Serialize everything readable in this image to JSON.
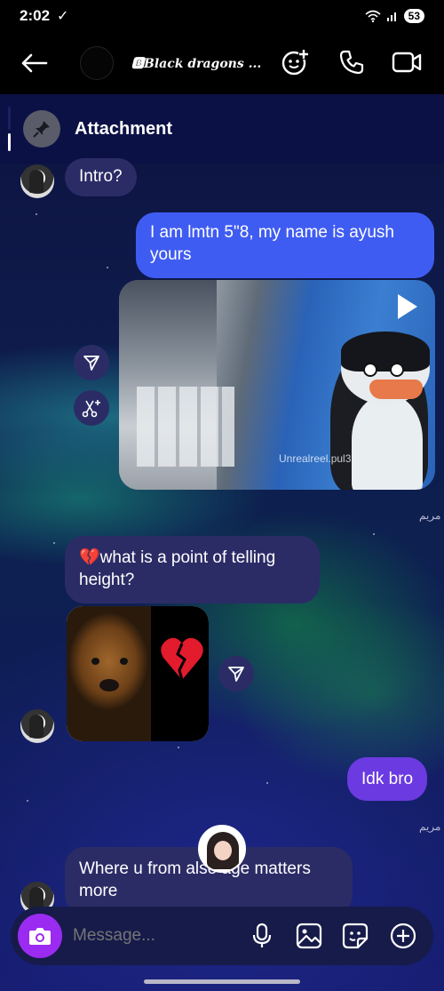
{
  "status_bar": {
    "time": "2:02",
    "battery": "53"
  },
  "header": {
    "title": "🅱Black dragons ..."
  },
  "pinned": {
    "label": "Attachment"
  },
  "messages": {
    "intro": "Intro?",
    "my_intro_line1": "I am lmtn 5\"8, my name is ayush",
    "my_intro_line2": "yours",
    "video_watermark": "Unrealreel.pul3",
    "seen_1": "مريم",
    "height_line1": "💔what is a point of telling",
    "height_line2": "height?",
    "idk": "Idk bro",
    "seen_2": "مريم",
    "where_line1": "Where u from also age matters",
    "where_line2": "more"
  },
  "composer": {
    "placeholder": "Message..."
  },
  "colors": {
    "incoming_bubble": "#2b2c66",
    "outgoing_bubble": "#3f5cf2",
    "outgoing_bubble_alt": "#6b3ae0",
    "camera_button": "#9b2bf0"
  },
  "icons": [
    "back-arrow-icon",
    "add-effect-icon",
    "phone-icon",
    "video-call-icon",
    "pin-icon",
    "share-icon",
    "remix-icon",
    "play-icon",
    "camera-icon",
    "mic-icon",
    "gallery-icon",
    "sticker-icon",
    "plus-icon"
  ]
}
